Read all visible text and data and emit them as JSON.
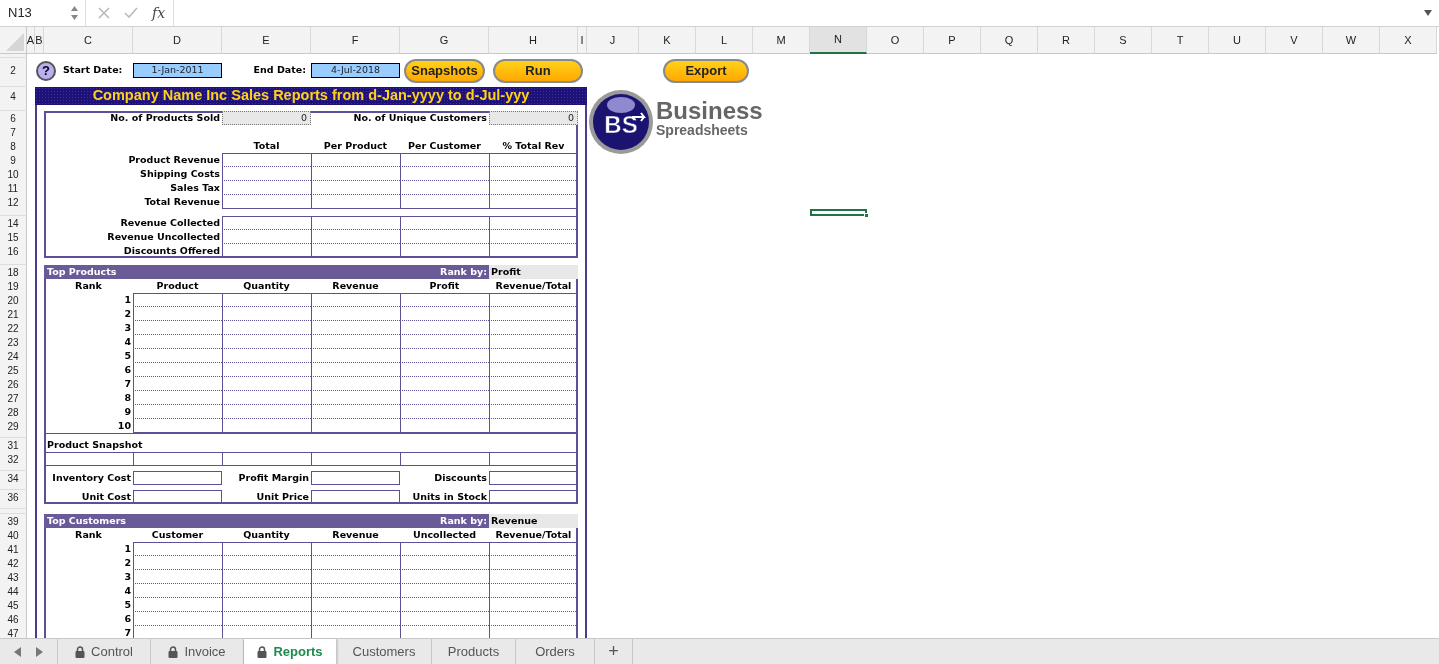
{
  "formula_bar": {
    "name_box": "N13",
    "function_label": "fx"
  },
  "columns": [
    {
      "label": "A",
      "selected": false
    },
    {
      "label": "B",
      "selected": false
    },
    {
      "label": "C",
      "selected": false
    },
    {
      "label": "D",
      "selected": false
    },
    {
      "label": "E",
      "selected": false
    },
    {
      "label": "F",
      "selected": false
    },
    {
      "label": "G",
      "selected": false
    },
    {
      "label": "H",
      "selected": false
    },
    {
      "label": "I",
      "selected": false
    },
    {
      "label": "J",
      "selected": false
    },
    {
      "label": "K",
      "selected": false
    },
    {
      "label": "L",
      "selected": false
    },
    {
      "label": "M",
      "selected": false
    },
    {
      "label": "N",
      "selected": true
    },
    {
      "label": "O",
      "selected": false
    },
    {
      "label": "P",
      "selected": false
    },
    {
      "label": "Q",
      "selected": false
    },
    {
      "label": "R",
      "selected": false
    },
    {
      "label": "S",
      "selected": false
    },
    {
      "label": "T",
      "selected": false
    },
    {
      "label": "U",
      "selected": false
    },
    {
      "label": "V",
      "selected": false
    },
    {
      "label": "W",
      "selected": false
    },
    {
      "label": "X",
      "selected": false
    }
  ],
  "rows": [
    "2",
    "4",
    "6",
    "7",
    "8",
    "9",
    "10",
    "11",
    "12",
    "14",
    "15",
    "16",
    "18",
    "19",
    "20",
    "21",
    "22",
    "23",
    "24",
    "25",
    "26",
    "27",
    "28",
    "29",
    "31",
    "32",
    "34",
    "36",
    "39",
    "40",
    "41",
    "42",
    "43",
    "44",
    "45",
    "46",
    "47"
  ],
  "controls": {
    "help": "?",
    "start_label": "Start Date:",
    "start_date": "1-Jan-2011",
    "end_label": "End Date:",
    "end_date": "4-Jul-2018",
    "buttons": [
      {
        "label": "Snapshots"
      },
      {
        "label": "Run"
      },
      {
        "label": "Export"
      }
    ]
  },
  "report": {
    "title": "Company Name Inc Sales Reports from d-Jan-yyyy to d-Jul-yyy",
    "summary": {
      "products_sold_label": "No. of Products Sold",
      "products_sold": "0",
      "customers_label": "No. of Unique Customers",
      "customers": "0",
      "columns": [
        "Total",
        "Per Product",
        "Per Customer",
        "% Total Rev"
      ],
      "groups": [
        [
          "Product Revenue",
          "Shipping Costs",
          "Sales Tax",
          "Total Revenue"
        ],
        [
          "Revenue Collected",
          "Revenue Uncollected",
          "Discounts Offered"
        ]
      ]
    },
    "top_products": {
      "title": "Top Products",
      "rank_by_label": "Rank by:",
      "rank_by": "Profit",
      "columns": [
        "Rank",
        "Product",
        "Quantity",
        "Revenue",
        "Profit",
        "Revenue/Total"
      ],
      "ranks": [
        "1",
        "2",
        "3",
        "4",
        "5",
        "6",
        "7",
        "8",
        "9",
        "10"
      ]
    },
    "product_snapshot": {
      "title": "Product Snapshot",
      "fields": [
        [
          "Inventory Cost",
          "Profit Margin",
          "Discounts"
        ],
        [
          "Unit Cost",
          "Unit Price",
          "Units in Stock"
        ]
      ]
    },
    "top_customers": {
      "title": "Top Customers",
      "rank_by_label": "Rank by:",
      "rank_by": "Revenue",
      "columns": [
        "Rank",
        "Customer",
        "Quantity",
        "Revenue",
        "Uncollected",
        "Revenue/Total"
      ],
      "ranks": [
        "1",
        "2",
        "3",
        "4",
        "5",
        "6",
        "7"
      ]
    }
  },
  "logo": {
    "monogram": "BS",
    "name": "Business",
    "tagline": "Spreadsheets"
  },
  "sheet_tabs": [
    {
      "label": "Control",
      "locked": true,
      "selected": false
    },
    {
      "label": "Invoice",
      "locked": true,
      "selected": false
    },
    {
      "label": "Reports",
      "locked": true,
      "selected": true
    },
    {
      "label": "Customers",
      "locked": false,
      "selected": false
    },
    {
      "label": "Products",
      "locked": false,
      "selected": false
    },
    {
      "label": "Orders",
      "locked": false,
      "selected": false
    }
  ],
  "add_tab": "+"
}
